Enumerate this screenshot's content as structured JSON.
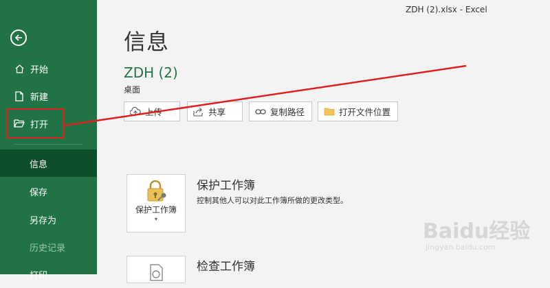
{
  "window": {
    "title": "ZDH (2).xlsx  -  Excel"
  },
  "sidebar": {
    "items": [
      {
        "label": "开始",
        "icon": "home-icon"
      },
      {
        "label": "新建",
        "icon": "new-document-icon"
      },
      {
        "label": "打开",
        "icon": "open-folder-icon"
      },
      {
        "label": "信息",
        "active": true
      },
      {
        "label": "保存"
      },
      {
        "label": "另存为"
      },
      {
        "label": "历史记录"
      },
      {
        "label": "打印"
      }
    ]
  },
  "main": {
    "title": "信息",
    "doc_name": "ZDH (2)",
    "doc_location": "桌面",
    "buttons": [
      {
        "label": "上传",
        "icon": "upload-icon"
      },
      {
        "label": "共享",
        "icon": "share-icon"
      },
      {
        "label": "复制路径",
        "icon": "link-icon"
      },
      {
        "label": "打开文件位置",
        "icon": "folder-icon"
      }
    ],
    "protect": {
      "card_label": "保护工作簿",
      "title": "保护工作簿",
      "description": "控制其他人可以对此工作簿所做的更改类型。"
    },
    "inspect": {
      "title": "检查工作簿"
    }
  },
  "watermark": {
    "brand": "Baidu经验",
    "url": "jingyan.baidu.com"
  },
  "colors": {
    "accent": "#217346",
    "active_nav": "#0f4e2a",
    "annotation": "#e02020"
  }
}
